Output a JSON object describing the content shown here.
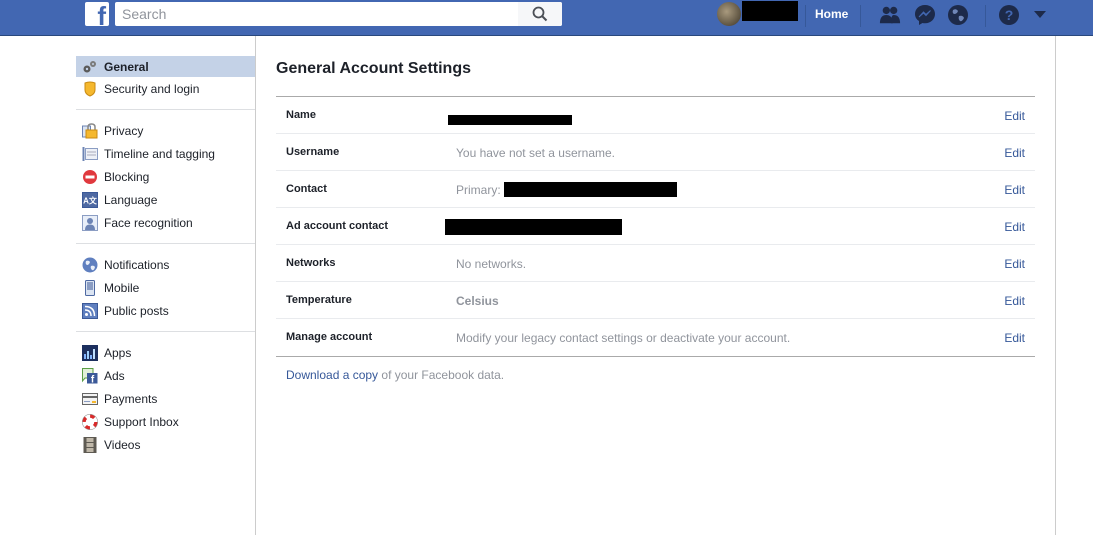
{
  "header": {
    "logo": "f",
    "search_placeholder": "Search",
    "home_label": "Home",
    "icons": [
      "friend-requests-icon",
      "messenger-icon",
      "notifications-globe-icon",
      "help-icon",
      "account-menu-caret-icon"
    ]
  },
  "sidebar": {
    "groups": [
      {
        "items": [
          {
            "label": "General",
            "icon": "gears-icon",
            "active": true
          },
          {
            "label": "Security and login",
            "icon": "shield-icon"
          }
        ]
      },
      {
        "items": [
          {
            "label": "Privacy",
            "icon": "padlock-icon"
          },
          {
            "label": "Timeline and tagging",
            "icon": "timeline-icon"
          },
          {
            "label": "Blocking",
            "icon": "blocking-icon"
          },
          {
            "label": "Language",
            "icon": "language-icon"
          },
          {
            "label": "Face recognition",
            "icon": "face-recognition-icon"
          }
        ]
      },
      {
        "items": [
          {
            "label": "Notifications",
            "icon": "globe-icon"
          },
          {
            "label": "Mobile",
            "icon": "mobile-icon"
          },
          {
            "label": "Public posts",
            "icon": "rss-icon"
          }
        ]
      },
      {
        "items": [
          {
            "label": "Apps",
            "icon": "apps-icon"
          },
          {
            "label": "Ads",
            "icon": "ads-icon"
          },
          {
            "label": "Payments",
            "icon": "credit-card-icon"
          },
          {
            "label": "Support Inbox",
            "icon": "lifebuoy-icon"
          },
          {
            "label": "Videos",
            "icon": "film-icon"
          }
        ]
      }
    ]
  },
  "main": {
    "title": "General Account Settings",
    "edit_label": "Edit",
    "rows": [
      {
        "label": "Name",
        "value": ""
      },
      {
        "label": "Username",
        "value": "You have not set a username."
      },
      {
        "label": "Contact",
        "value": "Primary:"
      },
      {
        "label": "Ad account contact",
        "value": ""
      },
      {
        "label": "Networks",
        "value": "No networks."
      },
      {
        "label": "Temperature",
        "value": "Celsius"
      },
      {
        "label": "Manage account",
        "value": "Modify your legacy contact settings or deactivate your account."
      }
    ],
    "footer": {
      "link": "Download a copy",
      "text": " of your Facebook data."
    }
  },
  "colors": {
    "brand": "#4267b2",
    "link": "#365899",
    "active_sidebar": "#c4d2e7"
  }
}
